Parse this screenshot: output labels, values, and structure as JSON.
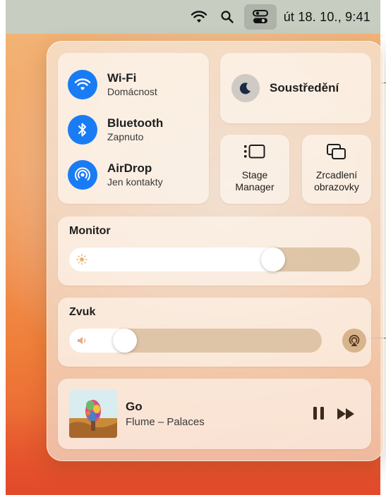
{
  "menubar": {
    "icons": [
      "wifi-icon",
      "search-icon",
      "control-center-icon"
    ],
    "clock": "út 18. 10.,  9:41"
  },
  "connectivity": {
    "items": [
      {
        "title": "Wi-Fi",
        "subtitle": "Domácnost",
        "icon": "wifi-icon"
      },
      {
        "title": "Bluetooth",
        "subtitle": "Zapnuto",
        "icon": "bluetooth-icon"
      },
      {
        "title": "AirDrop",
        "subtitle": "Jen kontakty",
        "icon": "airdrop-icon"
      }
    ]
  },
  "focus": {
    "label": "Soustředění",
    "icon": "moon-icon"
  },
  "stage_manager": {
    "line1": "Stage",
    "line2": "Manager",
    "icon": "stage-manager-icon"
  },
  "screen_mirroring": {
    "line1": "Zrcadlení",
    "line2": "obrazovky",
    "icon": "screen-mirroring-icon"
  },
  "monitor": {
    "title": "Monitor",
    "brightness_fraction": 0.72
  },
  "sound": {
    "title": "Zvuk",
    "volume_fraction": 0.19
  },
  "now_playing": {
    "title": "Go",
    "subtitle": "Flume – Palaces"
  },
  "colors": {
    "accent": "#1a7cf5",
    "menubar": "#c7cdc0"
  }
}
